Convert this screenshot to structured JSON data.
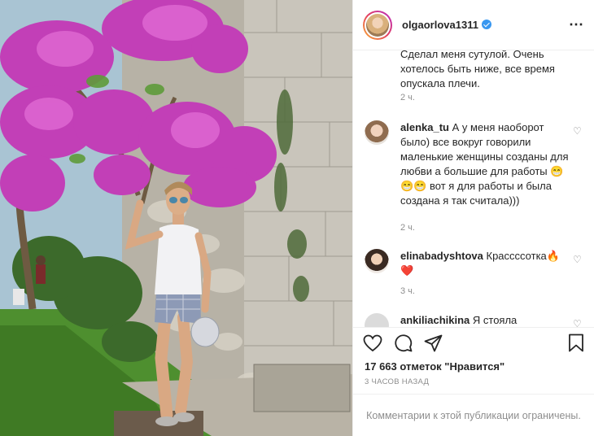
{
  "post": {
    "username": "olgaorlova1311",
    "verified": true
  },
  "comments": {
    "first_text": "Сделал меня сутулой. Очень хотелось быть ниже, все время опускала плечи.",
    "first_time": "2 ч.",
    "items": [
      {
        "user": "alenka_tu",
        "text": "А у меня наоборот было) все вокруг говорили маленькие женщины созданы для любви а большие для работы 😁😁😁 вот я для работы и была создана я так считала)))",
        "time": "2 ч."
      },
      {
        "user": "elinabadyshtova",
        "text": "Крассссотка🔥❤️",
        "time": "3 ч."
      },
      {
        "user": "ankiliachikina",
        "text": "Я стояла",
        "time": ""
      }
    ]
  },
  "footer": {
    "likes": "17 663 отметок \"Нравится\"",
    "posted_ago": "3 ЧАСОВ НАЗАД",
    "comments_closed": "Комментарии к этой публикации ограничены."
  },
  "icons": {
    "like": "heart-icon",
    "comment": "comment-bubble-icon",
    "share": "paper-plane-icon",
    "save": "bookmark-icon",
    "more": "more-options-icon",
    "comment_like": "small-heart-icon"
  },
  "colors": {
    "verified": "#3897f0",
    "flowers": "#c23fb7",
    "muted_text": "#8e8e8e"
  }
}
